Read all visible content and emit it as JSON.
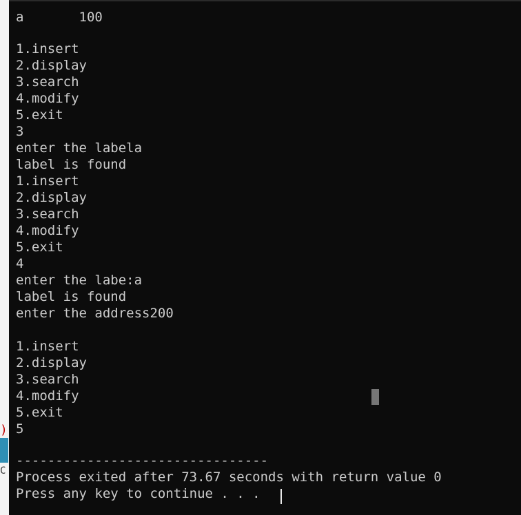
{
  "side_marks": [
    ")",
    "C"
  ],
  "console": {
    "lines": [
      "a       100",
      "",
      "1.insert",
      "2.display",
      "3.search",
      "4.modify",
      "5.exit",
      "3",
      "enter the labela",
      "label is found",
      "1.insert",
      "2.display",
      "3.search",
      "4.modify",
      "5.exit",
      "4",
      "enter the labe:a",
      "label is found",
      "enter the address200",
      "",
      "1.insert",
      "2.display",
      "3.search",
      "4.modify",
      "5.exit",
      "5",
      "",
      "--------------------------------",
      "Process exited after 73.67 seconds with return value 0",
      "Press any key to continue . . . "
    ]
  },
  "colors": {
    "background": "#0c0c0c",
    "text": "#cccccc"
  }
}
